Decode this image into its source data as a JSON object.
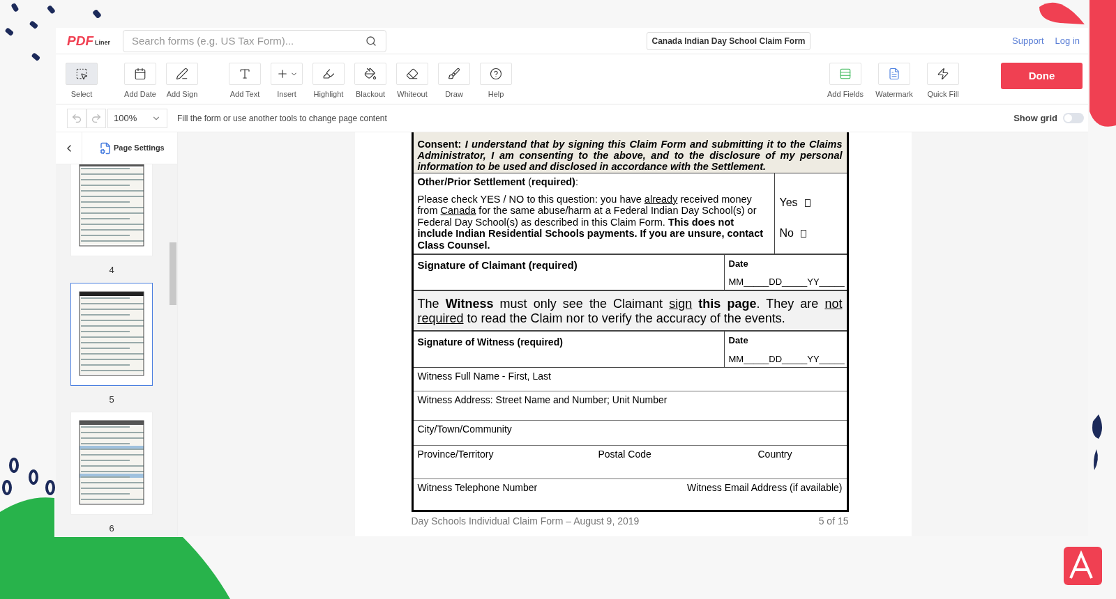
{
  "header": {
    "logo_main": "PDF",
    "logo_sub": "Liner",
    "search": {
      "placeholder": "Search forms (e.g. US Tax Form)..."
    },
    "document_title": "Canada Indian Day School Claim Form",
    "links": [
      "Support",
      "Log in"
    ]
  },
  "toolbar": {
    "left": [
      {
        "label": "Select",
        "selected": true
      },
      {
        "label": "Add Date",
        "selected": false
      },
      {
        "label": "Add Sign",
        "selected": false
      },
      {
        "label": "Add Text",
        "selected": false
      },
      {
        "label": "Insert",
        "selected": false
      },
      {
        "label": "Highlight",
        "selected": false
      },
      {
        "label": "Blackout",
        "selected": false
      },
      {
        "label": "Whiteout",
        "selected": false
      },
      {
        "label": "Draw",
        "selected": false
      },
      {
        "label": "Help",
        "selected": false
      }
    ],
    "right": [
      {
        "label": "Add Fields"
      },
      {
        "label": "Watermark"
      },
      {
        "label": "Quick Fill"
      }
    ],
    "done": "Done"
  },
  "subbar": {
    "zoom": "100%",
    "hint": "Fill the form or use another tools to change page content",
    "show_grid": {
      "label": "Show grid",
      "on": false
    }
  },
  "sidebar": {
    "page_settings": "Page Settings",
    "thumbnails": [
      {
        "label": "4",
        "selected": false
      },
      {
        "label": "5",
        "selected": true
      },
      {
        "label": "6",
        "selected": false
      }
    ]
  },
  "document": {
    "consent": [
      {
        "t": "Consent: ",
        "kind": "bold"
      },
      {
        "t": "I understand that by signing this Claim Form and submitting it to the Claims Administrator, I am consenting to the above, and to the disclosure of my personal information to be used and disclosed in accordance with the Settlement.",
        "kind": "bolditalic"
      }
    ],
    "prior_title": [
      {
        "t": "Other/Prior Settlement",
        "kind": "bold"
      },
      {
        "t": " (",
        "kind": "plain"
      },
      {
        "t": "required)",
        "kind": "bold"
      },
      {
        "t": ":",
        "kind": "plain"
      }
    ],
    "prior_text": [
      {
        "t": "Please check YES / NO to this question: you have ",
        "kind": "plain"
      },
      {
        "t": "already",
        "kind": "underline"
      },
      {
        "t": " received money from ",
        "kind": "plain"
      },
      {
        "t": "Canada",
        "kind": "underline"
      },
      {
        "t": " for the same abuse/harm at a Federal Indian Day School(s) or Federal Day School(s) as described in this Claim Form. ",
        "kind": "plain"
      },
      {
        "t": "This does not include Indian Residential Schools payments. If you are unsure, contact Class Counsel.",
        "kind": "bold"
      }
    ],
    "options": [
      {
        "label": "Yes",
        "checked": false
      },
      {
        "label": "No",
        "checked": false
      }
    ],
    "claimant_signature": {
      "label": "Signature of Claimant (required)",
      "date_label": "Date",
      "date_format": "MM_____DD_____YY_____"
    },
    "witness_note": [
      {
        "t": "The ",
        "kind": "plain"
      },
      {
        "t": "Witness",
        "kind": "bold"
      },
      {
        "t": " must only see the Claimant ",
        "kind": "plain"
      },
      {
        "t": "sign",
        "kind": "underline"
      },
      {
        "t": " this page",
        "kind": "bold"
      },
      {
        "t": ". They are ",
        "kind": "plain"
      },
      {
        "t": "not required",
        "kind": "underline"
      },
      {
        "t": " to read the Claim nor to verify the accuracy of the events.",
        "kind": "plain"
      }
    ],
    "witness_signature": {
      "label": "Signature of Witness (required)",
      "date_label": "Date",
      "date_format": "MM_____DD_____YY_____"
    },
    "fields": [
      {
        "kind": "single",
        "labels": [
          "Witness Full Name - First, Last"
        ]
      },
      {
        "kind": "single",
        "labels": [
          "Witness Address: Street Name and Number; Unit Number"
        ]
      },
      {
        "kind": "single",
        "labels": [
          "City/Town/Community"
        ]
      },
      {
        "kind": "triple",
        "labels": [
          "Province/Territory",
          "Postal Code",
          "Country"
        ]
      },
      {
        "kind": "pair",
        "labels": [
          "Witness Telephone Number",
          "Witness Email Address (if available)"
        ]
      }
    ],
    "footer_left": "Day Schools Individual Claim Form – August 9, 2019",
    "footer_right": "5 of 15"
  }
}
